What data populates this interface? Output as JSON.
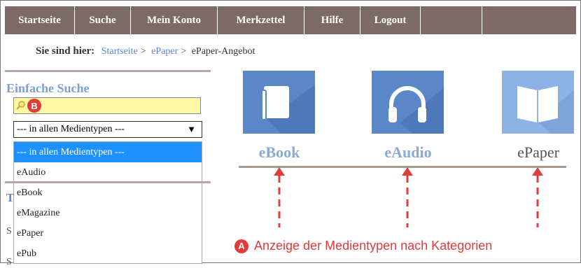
{
  "nav": {
    "items": [
      "Startseite",
      "Suche",
      "Mein Konto",
      "Merkzettel",
      "Hilfe",
      "Logout",
      ""
    ]
  },
  "breadcrumb": {
    "prefix": "Sie sind hier:",
    "items": [
      "Startseite",
      "ePaper",
      "ePaper-Angebot"
    ],
    "separator": ">"
  },
  "sidebar": {
    "heading": "Einfache Suche",
    "search_value": "",
    "badge_b": "B",
    "select_value": "--- in allen Medientypen ---",
    "options": [
      "--- in allen Medientypen ---",
      "eAudio",
      "eBook",
      "eMagazine",
      "ePaper",
      "ePub"
    ],
    "fragment_1": "T",
    "fragment_2": "S",
    "fragment_3": "S"
  },
  "categories": [
    {
      "label": "eBook",
      "icon": "book-icon"
    },
    {
      "label": "eAudio",
      "icon": "headphones-icon"
    },
    {
      "label": "ePaper",
      "icon": "open-book-icon"
    }
  ],
  "annotation": {
    "badge_a": "A",
    "text": "Anzeige der Medientypen nach Kategorien"
  },
  "colors": {
    "nav_bg": "#7b6a66",
    "link": "#5b86c8",
    "tile_blue": "#5b86c8",
    "tile_light": "#8fb2e4",
    "highlight": "#1e90ff",
    "annotation_red": "#e23b3b",
    "search_bg": "#fbf8a6"
  }
}
